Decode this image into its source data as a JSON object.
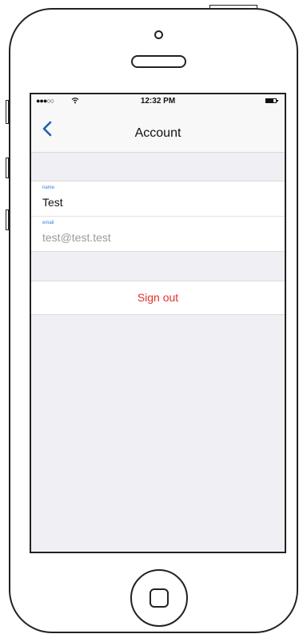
{
  "status_bar": {
    "signal": "●●●○○",
    "time": "12:32 PM"
  },
  "nav": {
    "title": "Account",
    "back_icon": "chevron-left-icon"
  },
  "profile": {
    "name_label": "name",
    "name_value": "Test",
    "email_label": "email",
    "email_value": "test@test.test"
  },
  "actions": {
    "sign_out_label": "Sign out"
  },
  "colors": {
    "accent": "#1f5fb0",
    "destructive": "#e0332a",
    "field_label": "#2e86de",
    "group_background": "#efeff4"
  }
}
